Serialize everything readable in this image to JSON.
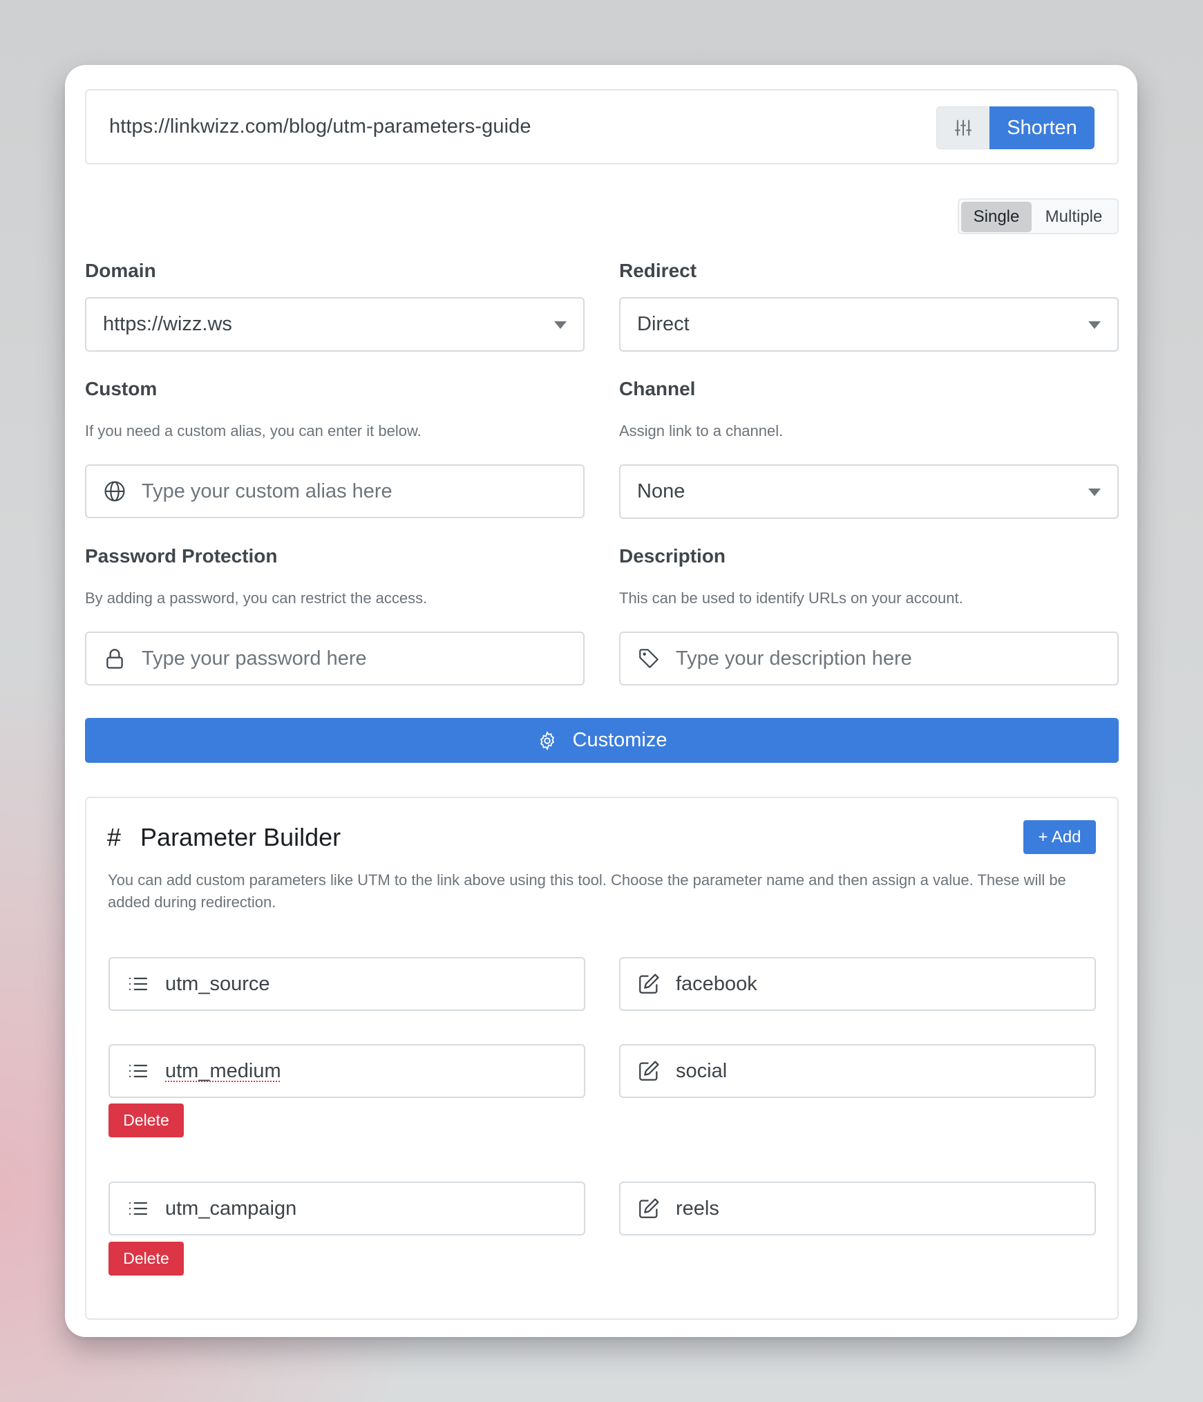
{
  "url_bar": {
    "value": "https://linkwizz.com/blog/utm-parameters-guide",
    "settings_icon": "sliders-icon",
    "shorten_label": "Shorten"
  },
  "mode_toggle": {
    "options": [
      "Single",
      "Multiple"
    ],
    "selected": "Single"
  },
  "form": {
    "domain": {
      "label": "Domain",
      "value": "https://wizz.ws"
    },
    "redirect": {
      "label": "Redirect",
      "value": "Direct"
    },
    "custom": {
      "label": "Custom",
      "help": "If you need a custom alias, you can enter it below.",
      "placeholder": "Type your custom alias here",
      "icon": "globe-icon"
    },
    "channel": {
      "label": "Channel",
      "help": "Assign link to a channel.",
      "value": "None"
    },
    "password": {
      "label": "Password Protection",
      "help": "By adding a password, you can restrict the access.",
      "placeholder": "Type your password here",
      "icon": "lock-icon"
    },
    "description": {
      "label": "Description",
      "help": "This can be used to identify URLs on your account.",
      "placeholder": "Type your description here",
      "icon": "tag-icon"
    }
  },
  "customize_button": {
    "label": "Customize",
    "icon": "gear-icon"
  },
  "parameter_builder": {
    "title": "Parameter Builder",
    "title_icon": "#",
    "add_label": "+ Add",
    "description": "You can add custom parameters like UTM to the link above using this tool. Choose the parameter name and then assign a value. These will be added during redirection.",
    "delete_label": "Delete",
    "params": [
      {
        "name": "utm_source",
        "value": "facebook",
        "deletable": false
      },
      {
        "name": "utm_medium",
        "value": "social",
        "deletable": true
      },
      {
        "name": "utm_campaign",
        "value": "reels",
        "deletable": true
      }
    ]
  },
  "colors": {
    "primary": "#3b7ddd",
    "danger": "#dc3545",
    "toggle_active": "#cdcfd1"
  }
}
